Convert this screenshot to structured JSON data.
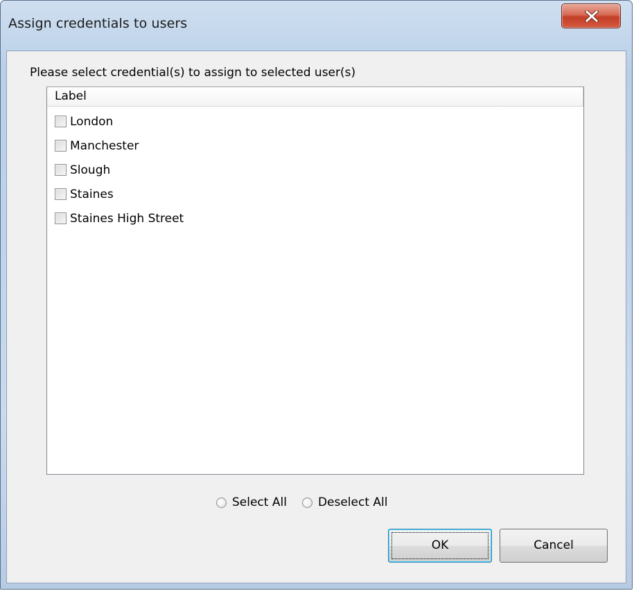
{
  "window": {
    "title": "Assign credentials to users"
  },
  "dialog": {
    "instruction": "Please select credential(s) to assign to selected user(s)",
    "list": {
      "column_header": "Label",
      "items": [
        {
          "label": "London",
          "checked": false
        },
        {
          "label": "Manchester",
          "checked": false
        },
        {
          "label": "Slough",
          "checked": false
        },
        {
          "label": "Staines",
          "checked": false
        },
        {
          "label": "Staines High Street",
          "checked": false
        }
      ]
    },
    "radios": {
      "select_all": "Select All",
      "deselect_all": "Deselect All"
    },
    "buttons": {
      "ok": "OK",
      "cancel": "Cancel"
    }
  },
  "colors": {
    "close_button": "#c43f28",
    "dialog_background": "#f0f0f0",
    "frame": "#b9cfe8"
  },
  "icons": {
    "close": "close-icon"
  }
}
